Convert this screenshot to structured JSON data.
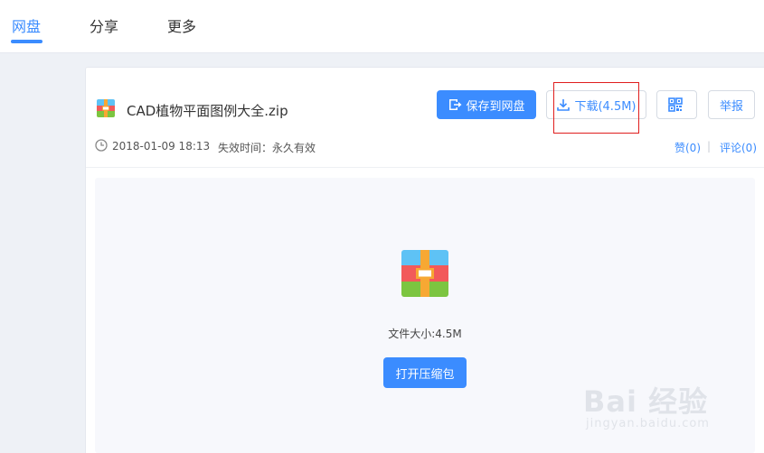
{
  "nav": {
    "tabs": [
      "网盘",
      "分享",
      "更多"
    ],
    "active_tab": 0
  },
  "file": {
    "name": "CAD植物平面图例大全.zip",
    "date": "2018-01-09 18:13",
    "expire": "失效时间：永久有效",
    "size": "文件大小:4.5M"
  },
  "actions": {
    "save_label": "保存到网盘",
    "download_label": "下载(4.5M)",
    "report_label": "举报",
    "like_label": "赞(0)",
    "comment_label": "评论(0)",
    "open_label": "打开压缩包"
  },
  "watermark": {
    "brand": "Bai 经验",
    "url": "jingyan.baidu.com"
  },
  "colors": {
    "accent": "#3b8cff",
    "highlight": "#e01e1e",
    "zip_top": "#5ec2f5",
    "zip_middle": "#f25a5a",
    "zip_bottom": "#7cc540",
    "zip_band": "#f7a833"
  }
}
